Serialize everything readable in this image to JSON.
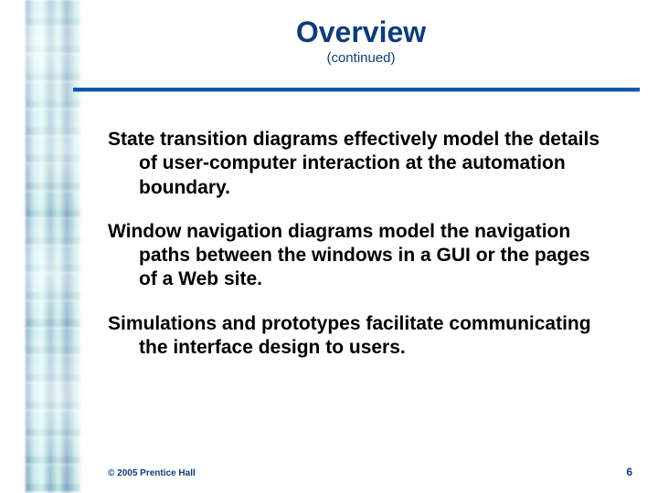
{
  "header": {
    "title": "Overview",
    "subtitle": "(continued)"
  },
  "body": {
    "paragraphs": [
      "State transition diagrams effectively model the details of user-computer interaction at the automation boundary.",
      "Window navigation diagrams model the navigation paths between the windows in a GUI or the pages of a Web site.",
      "Simulations and prototypes facilitate communicating the interface design to users."
    ]
  },
  "footer": {
    "copyright": "© 2005  Prentice Hall",
    "page_number": "6"
  },
  "colors": {
    "heading": "#0b3d7a",
    "rule": "#0b5ab0"
  }
}
